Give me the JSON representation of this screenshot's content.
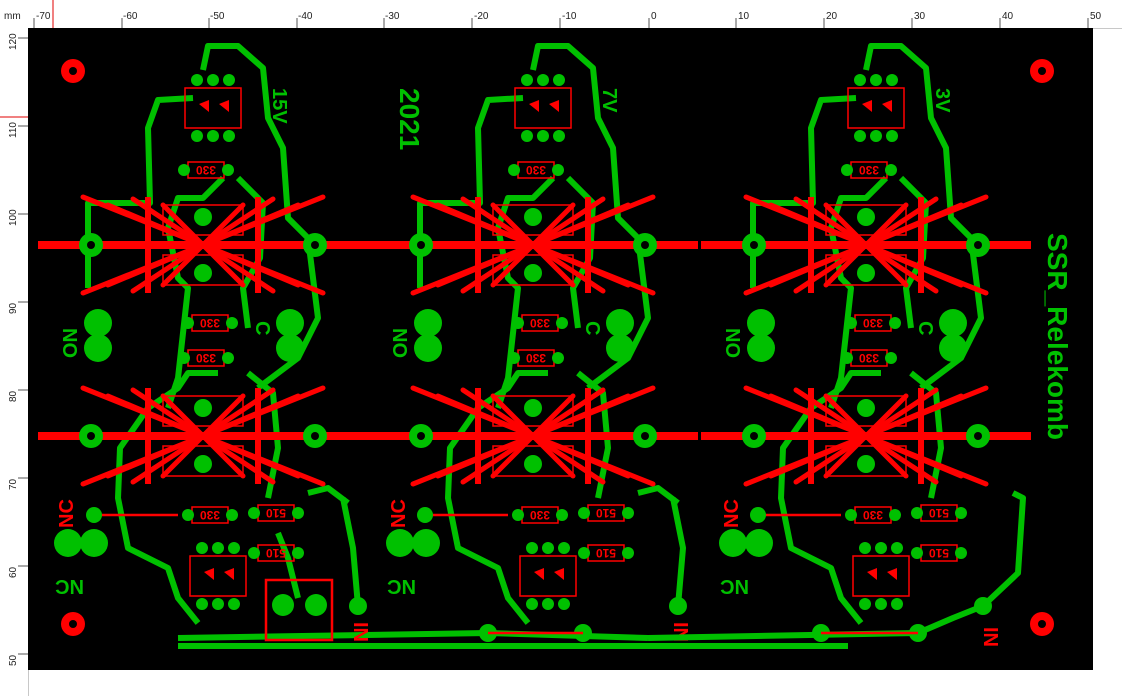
{
  "ruler": {
    "unit": "mm",
    "top_labels": [
      "-70",
      "-60",
      "-50",
      "-40",
      "-30",
      "-20",
      "-10",
      "0",
      "10",
      "20",
      "30",
      "40",
      "50"
    ],
    "left_labels": [
      "120",
      "110",
      "100",
      "90",
      "80",
      "70",
      "60",
      "50"
    ]
  },
  "board": {
    "title": "SSR_Relekomb",
    "year": "2021",
    "channels": [
      {
        "voltage": "15V",
        "nc_top": "NC",
        "nc_bottom": "NC",
        "no": "NO",
        "c": "C",
        "in": "IN"
      },
      {
        "voltage": "7V",
        "nc_top": "NC",
        "nc_bottom": "NC",
        "no": "NO",
        "c": "C",
        "in": "IN"
      },
      {
        "voltage": "3V",
        "nc_top": "NC",
        "nc_bottom": "NC",
        "no": "NO",
        "c": "C",
        "in": "IN"
      }
    ],
    "resistor_labels": [
      "330",
      "330",
      "330",
      "330",
      "510",
      "510"
    ],
    "colors": {
      "background": "#000000",
      "copper": "#00c000",
      "silkscreen": "#ff0000",
      "ruler_bg": "#ffffff"
    }
  }
}
